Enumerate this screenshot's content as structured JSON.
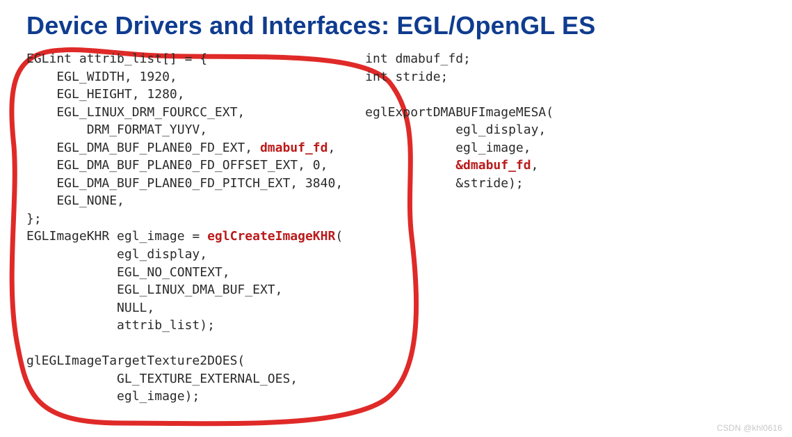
{
  "title": "Device Drivers and Interfaces: EGL/OpenGL ES",
  "colors": {
    "title": "#0f3c8f",
    "highlight": "#bb1b1b",
    "annotation_stroke": "#df2a28"
  },
  "watermark": "CSDN @khl0616",
  "code_left": {
    "l01": "EGLint attrib_list[] = {",
    "l02": "    EGL_WIDTH, 1920,",
    "l03": "    EGL_HEIGHT, 1280,",
    "l04": "    EGL_LINUX_DRM_FOURCC_EXT,",
    "l05": "        DRM_FORMAT_YUYV,",
    "l06a": "    EGL_DMA_BUF_PLANE0_FD_EXT, ",
    "l06b": "dmabuf_fd",
    "l06c": ",",
    "l07": "    EGL_DMA_BUF_PLANE0_FD_OFFSET_EXT, 0,",
    "l08": "    EGL_DMA_BUF_PLANE0_FD_PITCH_EXT, 3840,",
    "l09": "    EGL_NONE,",
    "l10": "};",
    "l11a": "EGLImageKHR egl_image = ",
    "l11b": "eglCreateImageKHR",
    "l11c": "(",
    "l12": "            egl_display,",
    "l13": "            EGL_NO_CONTEXT,",
    "l14": "            EGL_LINUX_DMA_BUF_EXT,",
    "l15": "            NULL,",
    "l16": "            attrib_list);",
    "blank1": "",
    "l17": "glEGLImageTargetTexture2DOES(",
    "l18": "            GL_TEXTURE_EXTERNAL_OES,",
    "l19": "            egl_image);"
  },
  "code_right": {
    "r01": "int dmabuf_fd;",
    "r02": "int stride;",
    "blank1": "",
    "r03": "eglExportDMABUFImageMESA(",
    "r04": "            egl_display,",
    "r05": "            egl_image,",
    "r06a": "            ",
    "r06b": "&dmabuf_fd",
    "r06c": ",",
    "r07": "            &stride);"
  }
}
